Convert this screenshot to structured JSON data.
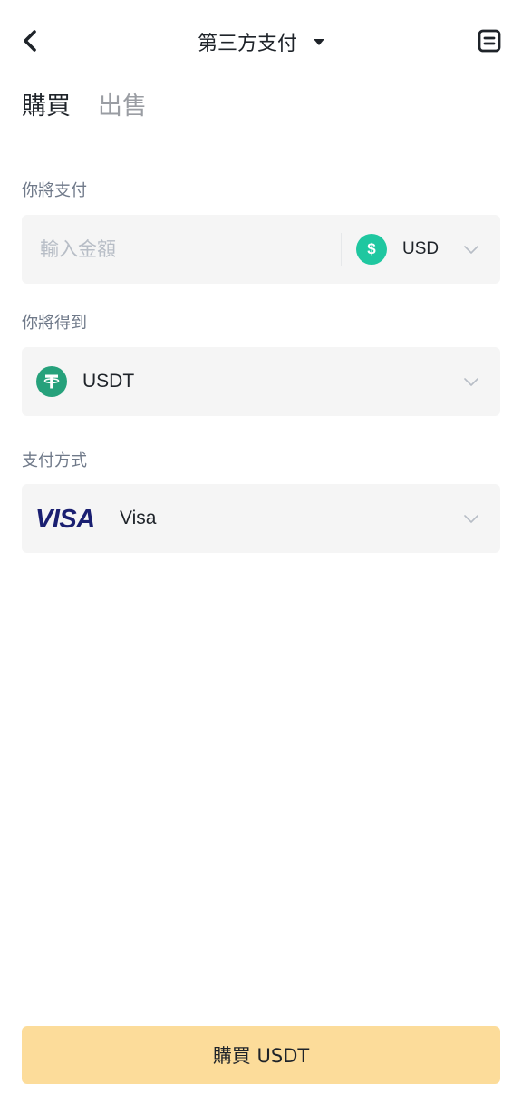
{
  "header": {
    "title": "第三方支付",
    "back_icon": "chevron-left-icon",
    "order_icon": "order-history-icon"
  },
  "tabs": [
    {
      "label": "購買",
      "active": true
    },
    {
      "label": "出售",
      "active": false
    }
  ],
  "pay": {
    "label": "你將支付",
    "input_value": "",
    "placeholder": "輸入金額",
    "currency": "USD",
    "currency_icon_glyph": "$",
    "currency_icon": "usd-coin-icon"
  },
  "receive": {
    "label": "你將得到",
    "asset": "USDT",
    "asset_icon": "tether-icon"
  },
  "payment_method": {
    "label": "支付方式",
    "logo_text": "VISA",
    "name": "Visa"
  },
  "buy_button": {
    "label": "購買 USDT"
  },
  "colors": {
    "accent": "#fcdc9a",
    "field_bg": "#f5f5f5",
    "usd_coin": "#1fc7a0",
    "tether": "#26a17b",
    "visa_blue": "#1a1f71",
    "text_secondary": "#707a8a",
    "placeholder": "#b7bdc6"
  }
}
